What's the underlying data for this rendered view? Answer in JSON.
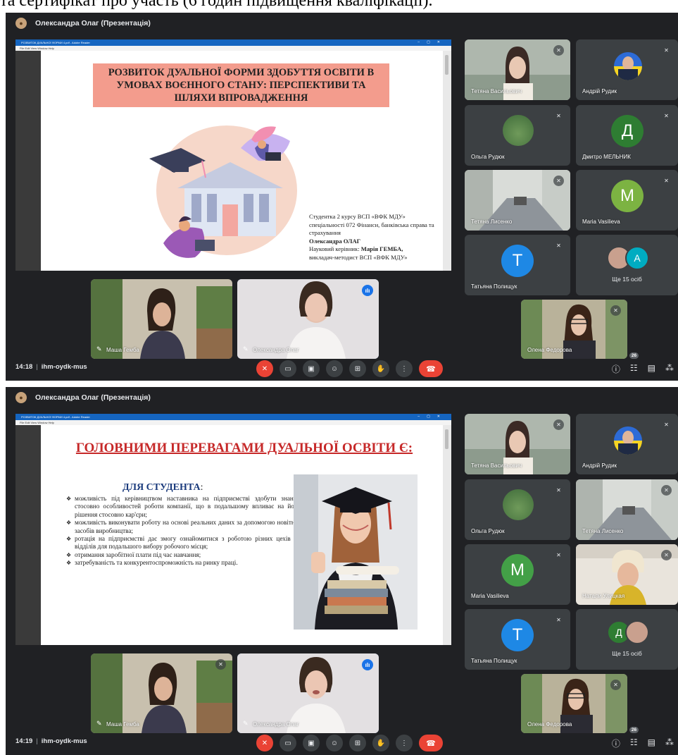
{
  "caption": "та сертифікат про участь (6 годин підвищення кваліфікації).",
  "colors": {
    "background": "#202124",
    "tile": "#3c4043",
    "danger": "#ea4335",
    "accent": "#1a73e8",
    "slide_title_red": "#c62828",
    "slide_banner": "#f39c8d"
  },
  "screens": [
    {
      "header": {
        "title": "Олександра Олаг (Презентація)"
      },
      "window": {
        "title": "РОЗВИТОК ДУАЛЬНОЇ ФОРМИ 4.pdf - Adobe Reader",
        "menu": "File   Edit   View   Window   Help"
      },
      "slide": {
        "banner": "РОЗВИТОК ДУАЛЬНОЇ ФОРМИ ЗДОБУТТЯ ОСВІТИ В УМОВАХ ВОЄННОГО СТАНУ: ПЕРСПЕКТИВИ ТА ШЛЯХИ ВПРОВАДЖЕННЯ",
        "info": {
          "line1": "Студентка 2 курсу ВСП «ВФК МДУ» спеціальності 072 Фінанси, банківська справа та страхування",
          "author": "Олександра ОЛАГ",
          "supervisor_prefix": "Науковий керівник: ",
          "supervisor": "Марія ГЕМБА,",
          "supervisor_role": "викладач-методист ВСП «ВФК МДУ»"
        }
      },
      "participants": [
        {
          "name": "Тетяна Васильович",
          "type": "video"
        },
        {
          "name": "Андрій Рудик",
          "type": "video"
        },
        {
          "name": "Ольга Рудюк",
          "type": "photo"
        },
        {
          "name": "Дмитро МЕЛЬНИК",
          "type": "avatar",
          "initial": "Д",
          "color": "#2e7d32"
        },
        {
          "name": "Тетяна Лисенко",
          "type": "video"
        },
        {
          "name": "Maria Vasilieva",
          "type": "avatar",
          "initial": "M",
          "color": "#7cb342"
        },
        {
          "name": "Татьяна Полищук",
          "type": "avatar",
          "initial": "T",
          "color": "#1e88e5"
        },
        {
          "name": "Ще 15 осіб",
          "type": "more",
          "initial": "A",
          "color": "#00acc1"
        },
        {
          "name": "Олена Федорова",
          "type": "video"
        },
        {
          "name": "Маша Гемба",
          "type": "video"
        },
        {
          "name": "Олександра Олаг",
          "type": "video"
        }
      ],
      "bottom": {
        "time": "14:18",
        "code": "ihm-oydk-mus",
        "people_count": "26"
      }
    },
    {
      "header": {
        "title": "Олександра Олаг (Презентація)"
      },
      "window": {
        "title": "РОЗВИТОК ДУАЛЬНОЇ ФОРМИ 4.pdf - Adobe Reader",
        "menu": "File   Edit   View   Window   Help"
      },
      "slide": {
        "title": "ГОЛОВНИМИ ПЕРЕВАГАМИ ДУАЛЬНОЇ ОСВІТИ Є:",
        "subtitle": "ДЛЯ СТУДЕНТА",
        "subtitle_suffix": ":",
        "bullets": [
          "можливість під керівництвом наставника на підприємстві здобути знання стосовно особливостей роботи компанії, що в подальшому впливає на його рішення стосовно кар'єри;",
          "можливість виконувати роботу на основі реальних даних за допомогою новітніх засобів виробництва;",
          "ротація на підприємстві дає змогу ознайомитися з роботою різних цехів та відділів для подальшого вибору робочого місця;",
          "отримання заробітної плати під час навчання;",
          "затребуваність та конкурентоспроможність на ринку праці."
        ]
      },
      "participants": [
        {
          "name": "Тетяна Васильович",
          "type": "video"
        },
        {
          "name": "Андрій Рудик",
          "type": "video"
        },
        {
          "name": "Ольга Рудюк",
          "type": "photo"
        },
        {
          "name": "Тетяна Лисенко",
          "type": "video"
        },
        {
          "name": "Maria Vasilieva",
          "type": "avatar",
          "initial": "M",
          "color": "#43a047"
        },
        {
          "name": "Натали Улицкая",
          "type": "video"
        },
        {
          "name": "Татьяна Полищук",
          "type": "avatar",
          "initial": "T",
          "color": "#1e88e5"
        },
        {
          "name": "Ще 15 осіб",
          "type": "more",
          "initial": "Д",
          "color": "#2e7d32"
        },
        {
          "name": "Олена Федорова",
          "type": "video"
        },
        {
          "name": "Маша Гемба",
          "type": "video"
        },
        {
          "name": "Олександра Олаг",
          "type": "video"
        }
      ],
      "bottom": {
        "time": "14:19",
        "code": "ihm-oydk-mus",
        "people_count": "26"
      }
    }
  ]
}
